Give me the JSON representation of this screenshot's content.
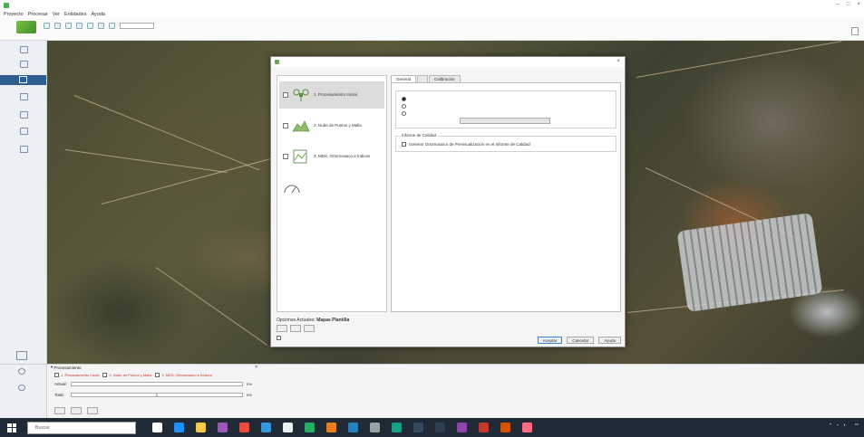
{
  "window": {
    "title": "",
    "controls": [
      "–",
      "□",
      "×"
    ]
  },
  "menu": [
    "Proyecto",
    "Procesar",
    "Ver",
    "Entidades",
    "Ayuda"
  ],
  "ribbon": {
    "combo_value": "",
    "sublabels": [
      "",
      "",
      ""
    ]
  },
  "sidebar": {
    "items": [
      {
        "label": "",
        "icon": "home-icon"
      },
      {
        "label": "",
        "icon": "folder-icon"
      },
      {
        "label": "",
        "icon": "layers-icon"
      },
      {
        "label": "",
        "icon": "grid-icon"
      },
      {
        "label": "",
        "icon": "chart-icon"
      },
      {
        "label": "",
        "icon": "table-icon"
      },
      {
        "label": "",
        "icon": "doc-icon"
      }
    ]
  },
  "dialog": {
    "title": "",
    "close": "×",
    "steps": [
      {
        "label": "1. Procesamiento Inicial",
        "checked": false,
        "selected": true,
        "icon": "drone-icon"
      },
      {
        "label": "2. Nube de Puntos y Malla",
        "checked": false,
        "selected": false,
        "icon": "pointcloud-icon"
      },
      {
        "label": "3. MDS, Ortomosaico e Índices",
        "checked": false,
        "selected": false,
        "icon": "dsm-icon"
      },
      {
        "label": "",
        "checked": false,
        "selected": false,
        "icon": "resources-icon"
      }
    ],
    "tabs": [
      {
        "label": "General",
        "active": true
      },
      {
        "label": "",
        "active": false
      },
      {
        "label": "Calibración",
        "active": false
      }
    ],
    "group1": {
      "title": "",
      "options": [
        {
          "label": "",
          "selected": true
        },
        {
          "label": "",
          "selected": false
        },
        {
          "label": "",
          "selected": false
        }
      ],
      "select_label": "",
      "select_value": ""
    },
    "group2": {
      "title": "Informe de Calidad",
      "checkbox_label": "Generar Ortomosaico de Previsualización en el Informe de Calidad",
      "checked": true
    },
    "current_template_label": "Opciones Actuales:",
    "current_template_value": "Mapas Plantilla",
    "template_buttons": [
      "",
      "",
      ""
    ],
    "autosave_label": "",
    "ok_label": "Aceptar",
    "cancel_label": "Cancelar",
    "help_label": "Ayuda"
  },
  "processing": {
    "title": "Procesamiento",
    "close": "×",
    "steps": [
      {
        "label": "1. Procesamiento Inicial",
        "checked": false
      },
      {
        "label": "2. Nube de Puntos y Malla",
        "checked": false
      },
      {
        "label": "3. MDS, Ortomosaico e Índices",
        "checked": false
      }
    ],
    "rows": [
      {
        "label": "Actual:",
        "progress": 0,
        "text": "",
        "pct": "0%"
      },
      {
        "label": "Total:",
        "progress": 0,
        "text": "0",
        "pct": "0%"
      }
    ],
    "buttons": [
      "",
      "",
      ""
    ],
    "side_labels": [
      "",
      "",
      ""
    ]
  },
  "statusbar": "",
  "taskbar": {
    "search_placeholder": "Buscar",
    "search_right": "",
    "apps": [
      {
        "icon": "cortana-icon",
        "color": "#ffffff"
      },
      {
        "icon": "edge-icon",
        "color": "#1e90ff"
      },
      {
        "icon": "files-icon",
        "color": "#f2c94c"
      },
      {
        "icon": "store-icon",
        "color": "#9b59b6"
      },
      {
        "icon": "chrome-icon",
        "color": "#e74c3c"
      },
      {
        "icon": "app-icon",
        "color": "#3498db"
      },
      {
        "icon": "doc-icon",
        "color": "#ecf0f1"
      },
      {
        "icon": "excel-icon",
        "color": "#27ae60"
      },
      {
        "icon": "powerpoint-icon",
        "color": "#e67e22"
      },
      {
        "icon": "word-icon",
        "color": "#2980b9"
      },
      {
        "icon": "app2-icon",
        "color": "#95a5a6"
      },
      {
        "icon": "app3-icon",
        "color": "#16a085"
      },
      {
        "icon": "app4-icon",
        "color": "#34495e"
      },
      {
        "icon": "app5-icon",
        "color": "#2c3e50"
      },
      {
        "icon": "app6-icon",
        "color": "#8e44ad"
      },
      {
        "icon": "app7-icon",
        "color": "#c0392b"
      },
      {
        "icon": "app8-icon",
        "color": "#d35400"
      },
      {
        "icon": "app9-icon",
        "color": "#ff6b81"
      }
    ],
    "time": "",
    "date": ""
  },
  "colors": {
    "accent": "#2f5d8f",
    "progress": "#06b025",
    "dialog_bg": "#f5f5f5",
    "step_selected": "#dcdcdc"
  }
}
